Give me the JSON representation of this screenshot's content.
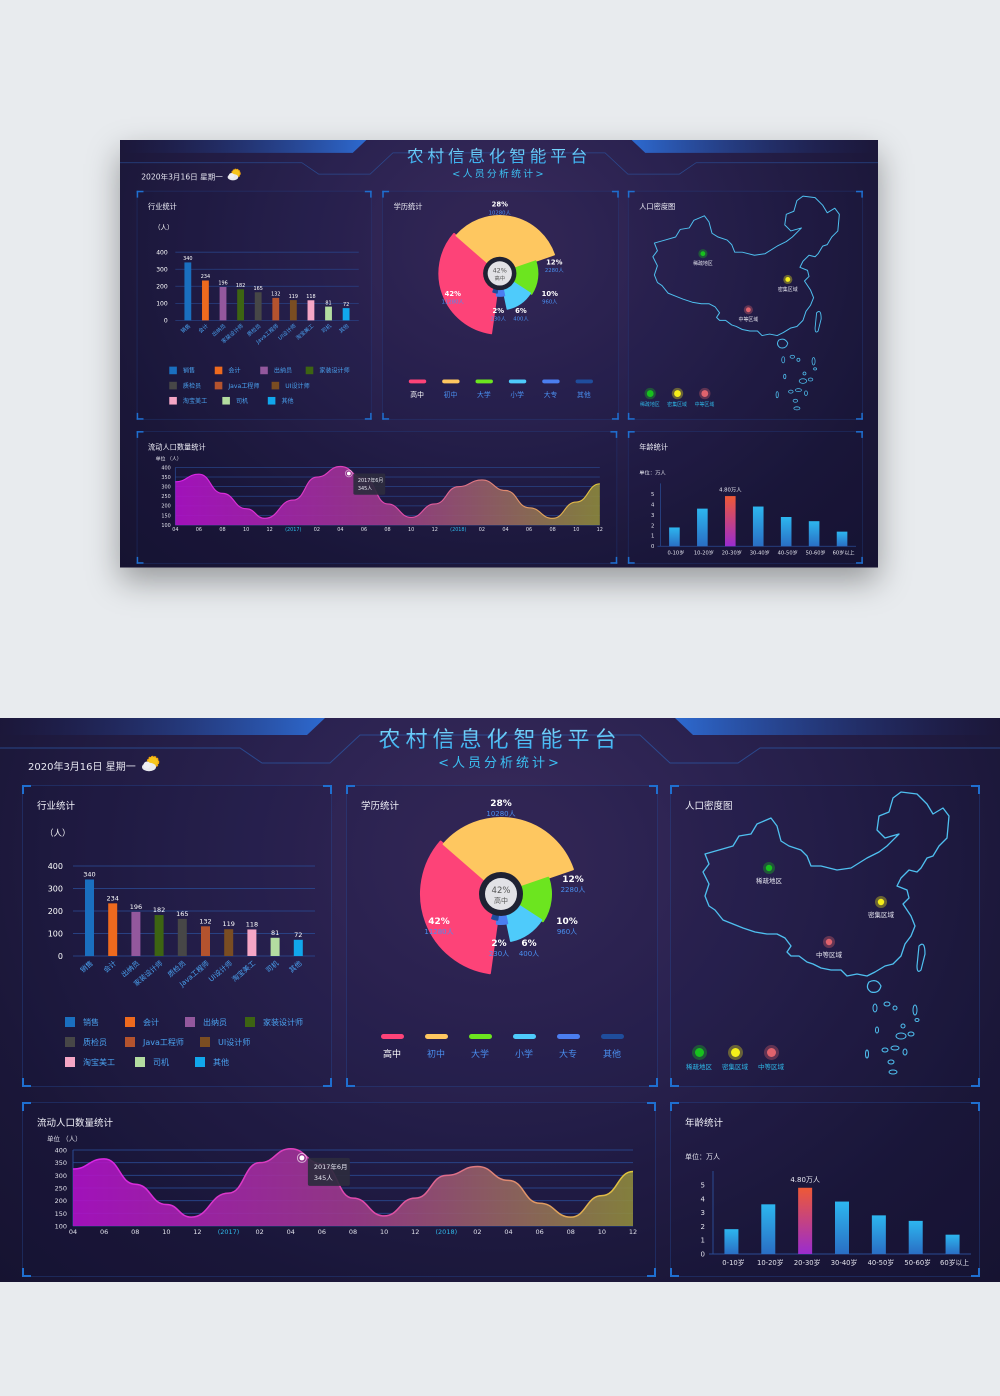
{
  "page": {
    "background": "#e8ebee"
  },
  "header": {
    "title": "农村信息化智能平台",
    "subtitle": "<人员分析统计>",
    "date": "2020年3月16日   星期一",
    "weather_icon": "partly-cloudy-sun-icon"
  },
  "panels": {
    "industry": {
      "title": "行业统计"
    },
    "education": {
      "title": "学历统计"
    },
    "density": {
      "title": "人口密度图"
    },
    "flow": {
      "title": "流动人口数量统计"
    },
    "age": {
      "title": "年龄统计"
    }
  },
  "density_map": {
    "markers": [
      {
        "label": "稀疏地区",
        "color": "#18c01e"
      },
      {
        "label": "密集区域",
        "color": "#f5ee1a"
      },
      {
        "label": "中等区域",
        "color": "#e0636d"
      }
    ],
    "legend": [
      {
        "label": "稀疏地区",
        "color": "#18c01e"
      },
      {
        "label": "密集区域",
        "color": "#f5ee1a"
      },
      {
        "label": "中等区域",
        "color": "#e0636d"
      }
    ]
  },
  "chart_data": [
    {
      "id": "industry",
      "type": "bar",
      "title": "行业统计",
      "ylabel": "（人）",
      "ylim": [
        0,
        400
      ],
      "yticks": [
        "0",
        "100",
        "200",
        "300",
        "400"
      ],
      "categories": [
        "销售",
        "会计",
        "出纳员",
        "家装设计师",
        "质检员",
        "Java工程师",
        "UI设计师",
        "淘宝美工",
        "司机",
        "其他"
      ],
      "values": [
        340,
        234,
        196,
        182,
        165,
        132,
        119,
        118,
        81,
        72
      ],
      "colors": [
        "#1a6fbf",
        "#ee6a1e",
        "#93589d",
        "#3d6412",
        "#474747",
        "#b4532e",
        "#7a4d22",
        "#f5a6c5",
        "#b3dca0",
        "#11a7ec"
      ],
      "legend": [
        "销售",
        "会计",
        "出纳员",
        "家装设计师",
        "质检员",
        "Java工程师",
        "UI设计师",
        "淘宝美工",
        "司机",
        "其他"
      ],
      "grid": true
    },
    {
      "id": "education",
      "type": "pie",
      "title": "学历统计",
      "center_label": {
        "value": "42%",
        "name": "高中"
      },
      "slices": [
        {
          "name": "高中",
          "percent": 42,
          "count": "11280人",
          "color": "#fd4378"
        },
        {
          "name": "初中",
          "percent": 28,
          "count": "10280人",
          "color": "#fec760"
        },
        {
          "name": "大学",
          "percent": 12,
          "count": "2280人",
          "color": "#6ce51f"
        },
        {
          "name": "小学",
          "percent": 10,
          "count": "960人",
          "color": "#4ecbfb"
        },
        {
          "name": "大专",
          "percent": 6,
          "count": "400人",
          "color": "#4b7ef0"
        },
        {
          "name": "其他",
          "percent": 2,
          "count": "230人",
          "color": "#1f4d9c"
        }
      ],
      "legend_position": "bottom"
    },
    {
      "id": "flow",
      "type": "area",
      "title": "流动人口数量统计",
      "ylabel": "单位 （人）",
      "ylim": [
        100,
        400
      ],
      "yticks": [
        "100",
        "150",
        "200",
        "250",
        "300",
        "350",
        "400"
      ],
      "xticks": [
        "04",
        "06",
        "08",
        "10",
        "12",
        "(2017)",
        "02",
        "04",
        "06",
        "08",
        "10",
        "12",
        "(2018)",
        "02",
        "04",
        "06",
        "08",
        "10",
        "12"
      ],
      "x": [
        0,
        1,
        2,
        3,
        3.8,
        5,
        6,
        7,
        8,
        9,
        10,
        11,
        12,
        13,
        14,
        15,
        16,
        17,
        18
      ],
      "values": [
        325,
        365,
        265,
        185,
        135,
        230,
        350,
        405,
        345,
        210,
        140,
        210,
        300,
        335,
        280,
        190,
        135,
        220,
        315
      ],
      "tooltip": {
        "title": "2017年6月",
        "value": "345人",
        "x_index": 8
      },
      "gradient": [
        "#b011c8",
        "#9c3a8a",
        "#8e8a3c"
      ],
      "grid": true
    },
    {
      "id": "age",
      "type": "bar",
      "title": "年龄统计",
      "ylabel": "单位：万人",
      "ylim": [
        0,
        5.5
      ],
      "yticks": [
        "0",
        "1",
        "2",
        "3",
        "4",
        "5"
      ],
      "categories": [
        "0-10岁",
        "10-20岁",
        "20-30岁",
        "30-40岁",
        "40-50岁",
        "50-60岁",
        "60岁以上"
      ],
      "values": [
        1.8,
        3.6,
        4.8,
        3.8,
        2.8,
        2.4,
        1.4
      ],
      "highlight": {
        "index": 2,
        "label": "4.80万人"
      },
      "bar_gradient": [
        "#2db6ef",
        "#2a6ec4"
      ],
      "highlight_gradient": [
        "#ee5936",
        "#9a2ccf"
      ]
    }
  ]
}
